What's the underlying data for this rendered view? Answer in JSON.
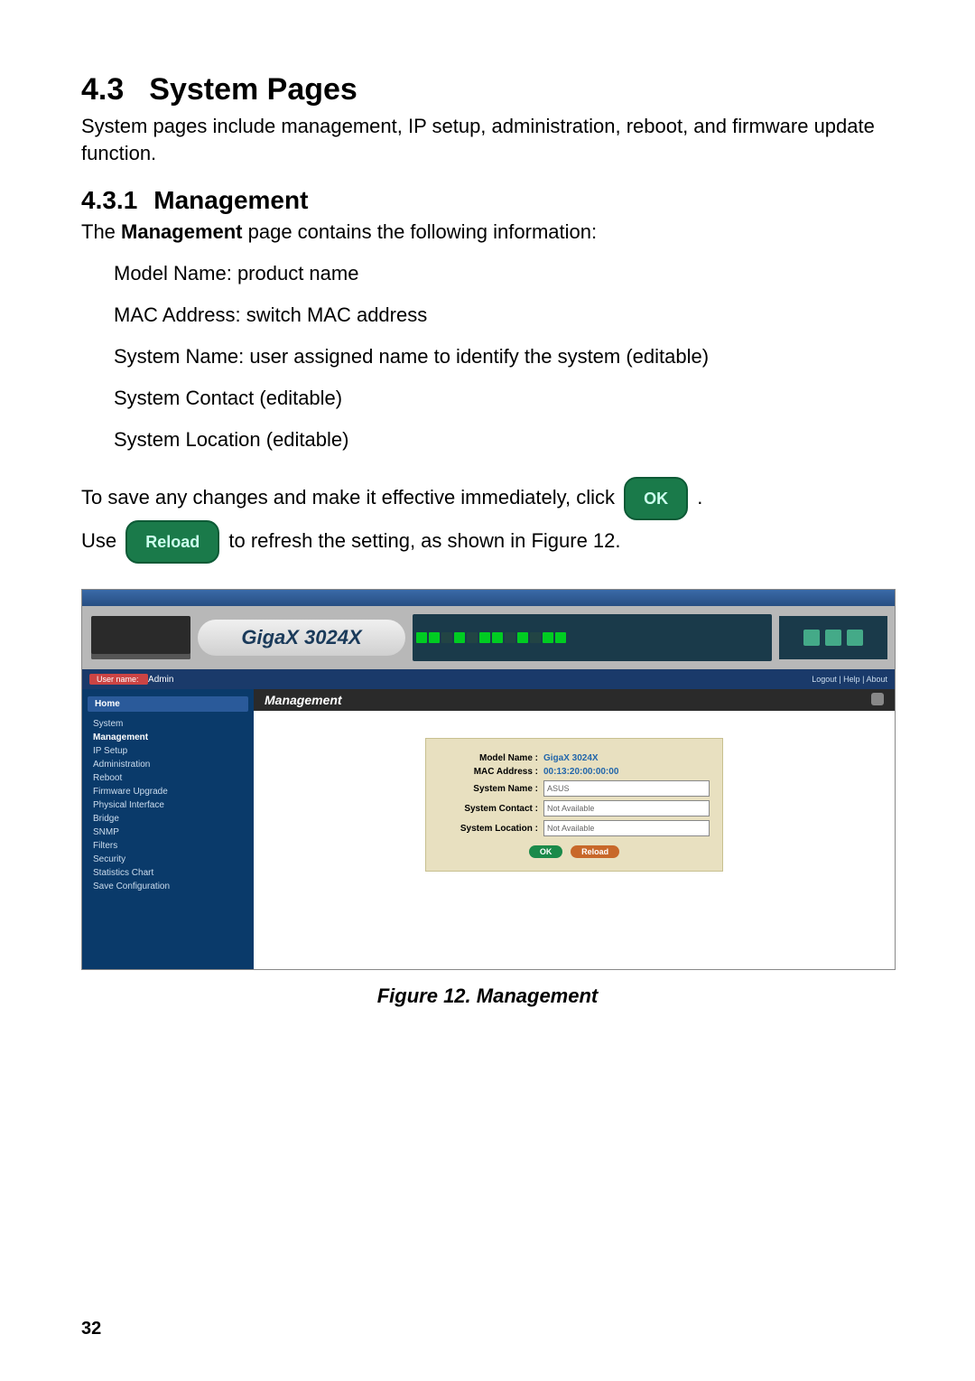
{
  "section": {
    "number": "4.3",
    "title": "System Pages",
    "intro": "System pages include management, IP setup, administration, reboot, and firmware update function."
  },
  "subsection": {
    "number": "4.3.1",
    "title": "Management",
    "lead_pre": "The ",
    "lead_bold": "Management",
    "lead_post": " page contains the following information:",
    "items": [
      "Model Name: product name",
      "MAC Address: switch MAC address",
      "System Name: user assigned name to identify the system (editable)",
      "System Contact (editable)",
      "System Location (editable)"
    ],
    "save_pre": "To save any changes and make it effective immediately, click ",
    "save_post": ".",
    "use_pre": "Use ",
    "use_post": " to refresh the setting, as shown in Figure 12."
  },
  "buttons": {
    "ok": "OK",
    "reload": "Reload"
  },
  "figure": {
    "caption": "Figure 12.  Management",
    "logo": "GigaX 3024X",
    "user_label": "User name:",
    "user_value": "Admin",
    "top_links": "Logout | Help | About",
    "home": "Home",
    "nav": [
      "System",
      "Management",
      "IP Setup",
      "Administration",
      "Reboot",
      "Firmware Upgrade",
      "Physical Interface",
      "Bridge",
      "SNMP",
      "Filters",
      "Security",
      "Statistics Chart",
      "Save Configuration"
    ],
    "panel_title": "Management",
    "form": {
      "model_label": "Model Name :",
      "model_value": "GigaX 3024X",
      "mac_label": "MAC Address :",
      "mac_value": "00:13:20:00:00:00",
      "sysname_label": "System Name :",
      "sysname_value": "ASUS",
      "contact_label": "System Contact :",
      "contact_value": "Not Available",
      "location_label": "System Location :",
      "location_value": "Not Available",
      "ok": "OK",
      "reload": "Reload"
    }
  },
  "page_number": "32"
}
